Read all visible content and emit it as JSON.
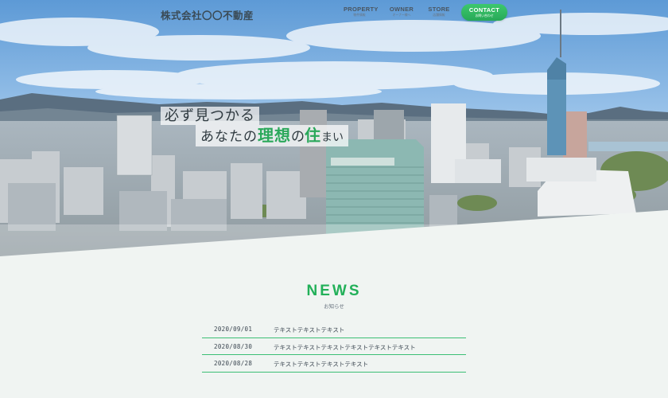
{
  "header": {
    "logo": "株式会社〇〇不動産",
    "nav": [
      {
        "en": "PROPERTY",
        "ja": "物件情報"
      },
      {
        "en": "OWNER",
        "ja": "オーナー様へ"
      },
      {
        "en": "STORE",
        "ja": "店舗情報"
      }
    ],
    "contact": {
      "en": "CONTACT",
      "ja": "お問い合わせ"
    }
  },
  "hero": {
    "catch_line1": "必ず見つかる",
    "catch_line2_pre": "あなたの",
    "catch_line2_highlight": "理想",
    "catch_line2_mid": "の",
    "catch_line2_highlight2": "住",
    "catch_line2_post": "まい"
  },
  "news": {
    "title": "NEWS",
    "subtitle": "お知らせ",
    "items": [
      {
        "date": "2020/09/01",
        "text": "テキストテキストテキスト"
      },
      {
        "date": "2020/08/30",
        "text": "テキストテキストテキストテキストテキストテキスト"
      },
      {
        "date": "2020/08/28",
        "text": "テキストテキストテキストテキスト"
      }
    ]
  },
  "colors": {
    "accent": "#2aa85a",
    "background": "#f0f4f2",
    "sky": "#5f9fd8"
  }
}
